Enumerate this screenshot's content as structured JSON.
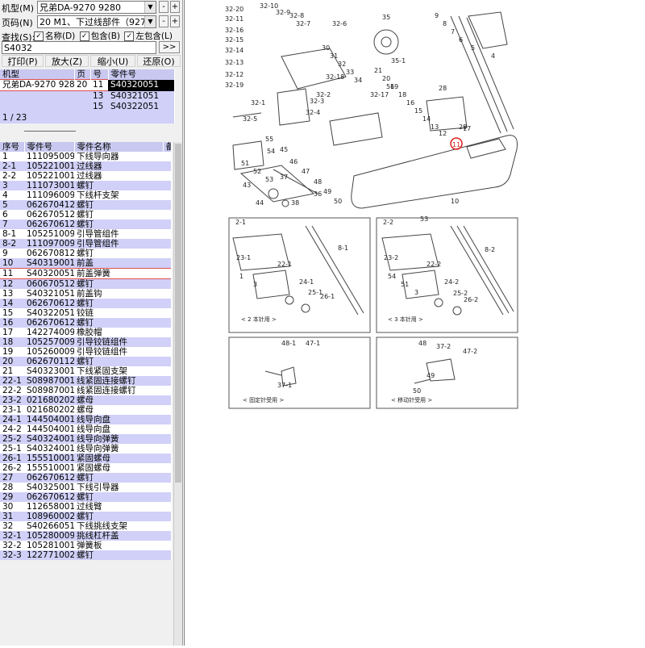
{
  "controls": {
    "model_label": "机型(M)",
    "model_value": "兄弟DA-9270 9280",
    "page_label": "页码(N)",
    "page_value": "20 M1、下过线部件（9270）",
    "search_label": "查找(S):",
    "opt_name": "名称(D)",
    "opt_contain": "包含(B)",
    "opt_left": "左包含(L)",
    "search_value": "S4032",
    "go": ">>",
    "minus": "-",
    "plus": "+"
  },
  "toolbar": [
    "打印(P)",
    "放大(Z)",
    "缩小(U)",
    "还原(O)"
  ],
  "top_table": {
    "headers": [
      "机型",
      "页",
      "号",
      "零件号"
    ],
    "rows": [
      [
        "兄弟DA-9270 9280",
        "20",
        "11",
        "S40320051"
      ],
      [
        "",
        "",
        "13",
        "S40321051"
      ],
      [
        "",
        "",
        "15",
        "S40322051"
      ]
    ],
    "status": "1 / 23"
  },
  "parts_table": {
    "headers": [
      "序号",
      "零件号",
      "零件名称",
      "备"
    ],
    "rows": [
      [
        "1",
        "111095009",
        "下线导向器"
      ],
      [
        "2-1",
        "105221001",
        "过线器"
      ],
      [
        "2-2",
        "105221001",
        "过线器"
      ],
      [
        "3",
        "111073001",
        "螺钉"
      ],
      [
        "4",
        "111096009",
        "下线杆支架"
      ],
      [
        "5",
        "062670412",
        "螺钉"
      ],
      [
        "6",
        "062670512",
        "螺钉"
      ],
      [
        "7",
        "062670612",
        "螺钉"
      ],
      [
        "8-1",
        "105251009",
        "引导管组件"
      ],
      [
        "8-2",
        "111097009",
        "引导管组件"
      ],
      [
        "9",
        "062670812",
        "螺钉"
      ],
      [
        "10",
        "S40319001",
        "前盖"
      ],
      [
        "11",
        "S40320051",
        "前盖弹簧"
      ],
      [
        "12",
        "060670512",
        "螺钉"
      ],
      [
        "13",
        "S40321051",
        "前盖钩"
      ],
      [
        "14",
        "062670612",
        "螺钉"
      ],
      [
        "15",
        "S40322051",
        "铰链"
      ],
      [
        "16",
        "062670612",
        "螺钉"
      ],
      [
        "17",
        "142274009",
        "橡胶帽"
      ],
      [
        "18",
        "105257009",
        "引导铰链组件"
      ],
      [
        "19",
        "105260009",
        "引导铰链组件"
      ],
      [
        "20",
        "062670112",
        "螺钉"
      ],
      [
        "21",
        "S40323001",
        "下线紧固支架"
      ],
      [
        "22-1",
        "S08987001",
        "线紧固连接螺钉"
      ],
      [
        "22-2",
        "S08987001",
        "线紧固连接螺钉"
      ],
      [
        "23-2",
        "021680202",
        "螺母"
      ],
      [
        "23-1",
        "021680202",
        "螺母"
      ],
      [
        "24-1",
        "144504001",
        "线导向盘"
      ],
      [
        "24-2",
        "144504001",
        "线导向盘"
      ],
      [
        "25-2",
        "S40324001",
        "线导向弹簧"
      ],
      [
        "25-1",
        "S40324001",
        "线导向弹簧"
      ],
      [
        "26-1",
        "155510001",
        "紧固螺母"
      ],
      [
        "26-2",
        "155510001",
        "紧固螺母"
      ],
      [
        "27",
        "062670612",
        "螺钉"
      ],
      [
        "28",
        "S40325001",
        "下线引导器"
      ],
      [
        "29",
        "062670612",
        "螺钉"
      ],
      [
        "30",
        "112658001",
        "过线臂"
      ],
      [
        "31",
        "108960002",
        "螺钉"
      ],
      [
        "32",
        "S40266051",
        "下线挑线支架"
      ],
      [
        "32-1",
        "105280009",
        "挑线杠杆盖"
      ],
      [
        "32-2",
        "105281001",
        "弹簧板"
      ],
      [
        "32-3",
        "122771002",
        "螺钉"
      ]
    ],
    "selected_index": 12
  },
  "diagram": {
    "labels_top": [
      "32-20",
      "32-11",
      "32-10",
      "32-9",
      "32-8",
      "32-7",
      "32-6",
      "32-4",
      "32-3",
      "32-2",
      "32-1",
      "32-5",
      "32-12",
      "32-13",
      "32-14",
      "32-15",
      "32-16",
      "32-17",
      "32-18",
      "32-19",
      "35",
      "35-1",
      "36",
      "37",
      "38",
      "43",
      "44",
      "45",
      "46",
      "47",
      "48",
      "49",
      "50",
      "51",
      "52",
      "53",
      "54",
      "55",
      "56",
      "4",
      "5",
      "6",
      "7",
      "8",
      "9",
      "10",
      "11",
      "12",
      "13",
      "14",
      "15",
      "16",
      "17",
      "18",
      "19",
      "20",
      "21",
      "28",
      "29",
      "30",
      "31",
      "32",
      "33",
      "34"
    ],
    "panel1_labels": [
      "2-1",
      "8-1",
      "23-1",
      "24-1",
      "25-1",
      "26-1",
      "22-1",
      "1",
      "3"
    ],
    "panel2_labels": [
      "2-2",
      "53",
      "8-2",
      "23-2",
      "24-2",
      "25-2",
      "26-2",
      "22-2",
      "54",
      "51",
      "3"
    ],
    "panel1_caption": "< 2 本针用 >",
    "panel2_caption": "< 3 本针用 >",
    "panel3_labels": [
      "48-1",
      "47-1",
      "37-1"
    ],
    "panel4_labels": [
      "48",
      "37-2",
      "47-2",
      "49",
      "50"
    ],
    "panel3_caption": "< 固定针受用 >",
    "panel4_caption": "< 移动针受用 >",
    "highlight": "11"
  }
}
